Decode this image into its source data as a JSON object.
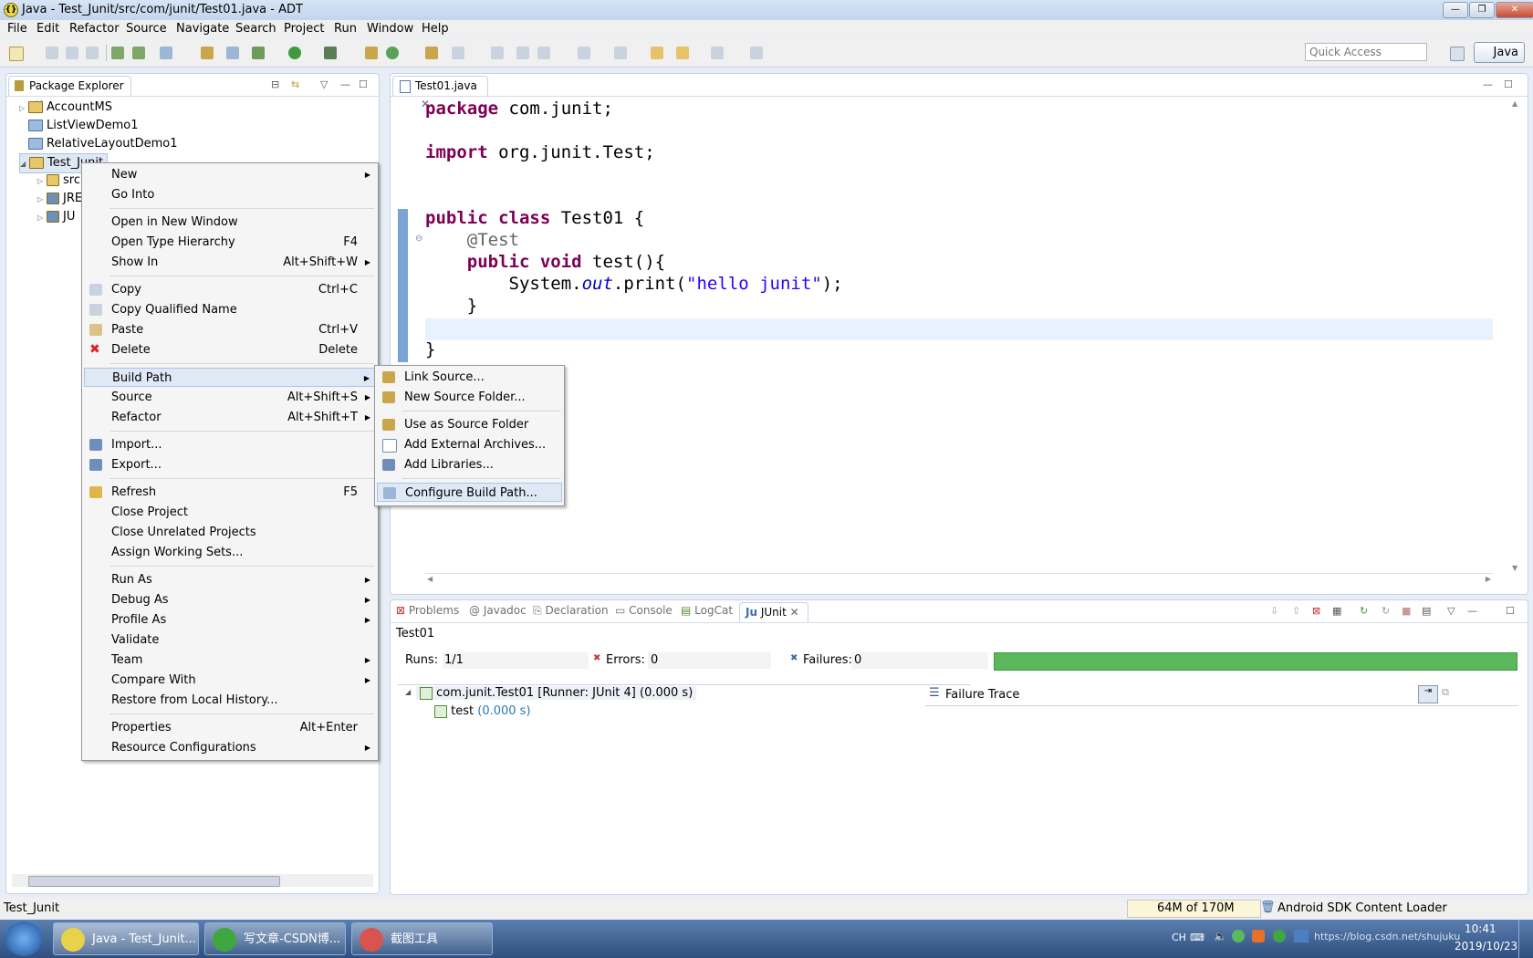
{
  "window": {
    "title": "Java - Test_Junit/src/com/junit/Test01.java - ADT",
    "min": "—",
    "max": "❐",
    "close": "✕"
  },
  "menubar": [
    "File",
    "Edit",
    "Refactor",
    "Source",
    "Navigate",
    "Search",
    "Project",
    "Run",
    "Window",
    "Help"
  ],
  "toolbar": {
    "quick_access_placeholder": "Quick Access",
    "perspective": "Java"
  },
  "package_explorer": {
    "tab": "Package Explorer",
    "items": [
      "AccountMS",
      "ListViewDemo1",
      "RelativeLayoutDemo1",
      "Test_Junit"
    ],
    "children": [
      "src",
      "JRE",
      "JU"
    ]
  },
  "editor": {
    "tab": "Test01.java",
    "code": [
      "package com.junit;",
      "",
      "import org.junit.Test;",
      "",
      "",
      "public class Test01 {",
      "    @Test",
      "    public void test(){",
      "        System.out.print(\"hello junit\");",
      "    }",
      "",
      "}"
    ]
  },
  "bottom_tabs": [
    "Problems",
    "Javadoc",
    "Declaration",
    "Console",
    "LogCat",
    "JUnit"
  ],
  "junit": {
    "class_name": "Test01",
    "runs_label": "Runs:",
    "runs_value": "1/1",
    "errors_label": "Errors:",
    "errors_value": "0",
    "failures_label": "Failures:",
    "failures_value": "0",
    "progress": 1.0,
    "progress_color": "#5cb85c",
    "tree_root": "com.junit.Test01 [Runner: JUnit 4] (0.000 s)",
    "tree_child": "test",
    "tree_child_time": "(0.000 s)",
    "failure_trace": "Failure Trace"
  },
  "context_menu": {
    "items": [
      {
        "label": "New",
        "shortcut": "",
        "submenu": true
      },
      {
        "label": "Go Into",
        "shortcut": "",
        "submenu": false
      },
      {
        "label": "Open in New Window",
        "shortcut": "",
        "submenu": false
      },
      {
        "label": "Open Type Hierarchy",
        "shortcut": "F4",
        "submenu": false
      },
      {
        "label": "Show In",
        "shortcut": "Alt+Shift+W",
        "submenu": true
      },
      {
        "label": "Copy",
        "shortcut": "Ctrl+C",
        "submenu": false
      },
      {
        "label": "Copy Qualified Name",
        "shortcut": "",
        "submenu": false
      },
      {
        "label": "Paste",
        "shortcut": "Ctrl+V",
        "submenu": false
      },
      {
        "label": "Delete",
        "shortcut": "Delete",
        "submenu": false
      },
      {
        "label": "Build Path",
        "shortcut": "",
        "submenu": true
      },
      {
        "label": "Source",
        "shortcut": "Alt+Shift+S",
        "submenu": true
      },
      {
        "label": "Refactor",
        "shortcut": "Alt+Shift+T",
        "submenu": true
      },
      {
        "label": "Import...",
        "shortcut": "",
        "submenu": false
      },
      {
        "label": "Export...",
        "shortcut": "",
        "submenu": false
      },
      {
        "label": "Refresh",
        "shortcut": "F5",
        "submenu": false
      },
      {
        "label": "Close Project",
        "shortcut": "",
        "submenu": false
      },
      {
        "label": "Close Unrelated Projects",
        "shortcut": "",
        "submenu": false
      },
      {
        "label": "Assign Working Sets...",
        "shortcut": "",
        "submenu": false
      },
      {
        "label": "Run As",
        "shortcut": "",
        "submenu": true
      },
      {
        "label": "Debug As",
        "shortcut": "",
        "submenu": true
      },
      {
        "label": "Profile As",
        "shortcut": "",
        "submenu": true
      },
      {
        "label": "Validate",
        "shortcut": "",
        "submenu": false
      },
      {
        "label": "Team",
        "shortcut": "",
        "submenu": true
      },
      {
        "label": "Compare With",
        "shortcut": "",
        "submenu": true
      },
      {
        "label": "Restore from Local History...",
        "shortcut": "",
        "submenu": false
      },
      {
        "label": "Properties",
        "shortcut": "Alt+Enter",
        "submenu": false
      },
      {
        "label": "Resource Configurations",
        "shortcut": "",
        "submenu": true
      }
    ]
  },
  "build_path_menu": [
    "Link Source...",
    "New Source Folder...",
    "Use as Source Folder",
    "Add External Archives...",
    "Add Libraries...",
    "Configure Build Path..."
  ],
  "statusbar": {
    "selection": "Test_Junit",
    "memory": "64M of 170M",
    "task": "Android SDK Content Loader"
  },
  "taskbar": {
    "buttons": [
      "Java - Test_Junit...",
      "写文章-CSDN博...",
      "截图工具"
    ],
    "tray_lang": "CH",
    "clock_time": "10:41",
    "clock_date": "2019/10/23",
    "watermark": "https://blog.csdn.net/shujuku"
  }
}
